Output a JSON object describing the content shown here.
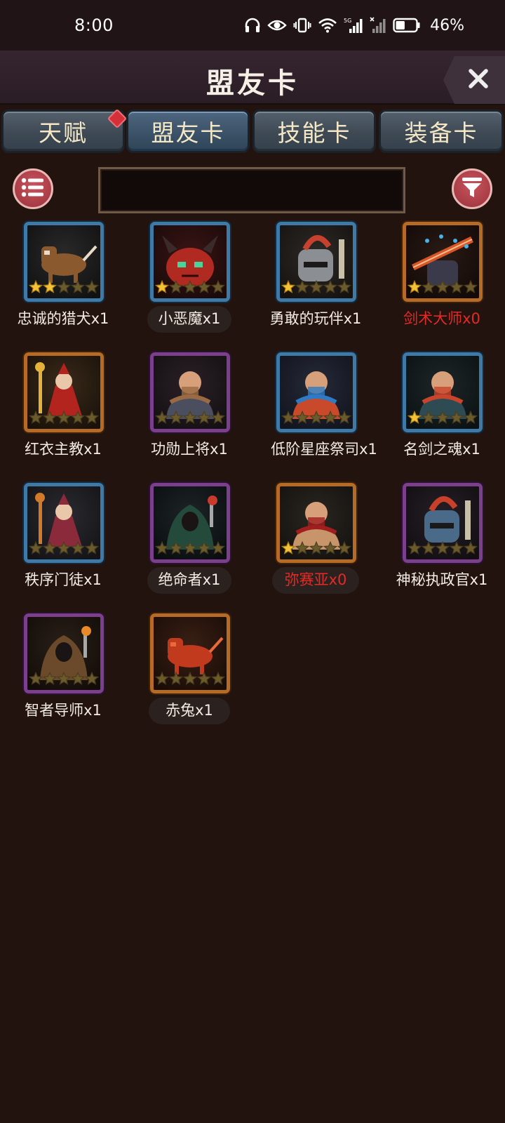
{
  "status_bar": {
    "time": "8:00",
    "battery_percent": "46%",
    "icons": [
      "headphones-icon",
      "eye-icon",
      "vibrate-icon",
      "wifi-icon",
      "signal-5g-icon",
      "signal-no-sim-icon",
      "battery-icon"
    ],
    "battery_level": 0.46
  },
  "header": {
    "title": "盟友卡",
    "close_icon": "close-icon"
  },
  "tabs": [
    {
      "label": "天赋",
      "active": false,
      "badge": true
    },
    {
      "label": "盟友卡",
      "active": true,
      "badge": false
    },
    {
      "label": "技能卡",
      "active": false,
      "badge": false
    },
    {
      "label": "装备卡",
      "active": false,
      "badge": false
    }
  ],
  "toolbar": {
    "list_icon": "list-icon",
    "filter_icon": "filter-icon",
    "search_value": ""
  },
  "cards": [
    {
      "name": "忠诚的猎犬x1",
      "frame": "blue",
      "stars": 2,
      "missing": false,
      "art": "hound"
    },
    {
      "name": "小恶魔x1",
      "frame": "blue",
      "stars": 1,
      "missing": false,
      "art": "imp"
    },
    {
      "name": "勇敢的玩伴x1",
      "frame": "blue",
      "stars": 1,
      "missing": false,
      "art": "knight-helmet"
    },
    {
      "name": "剑术大师x0",
      "frame": "orange",
      "stars": 1,
      "missing": true,
      "art": "swordmaster"
    },
    {
      "name": "红衣主教x1",
      "frame": "orange",
      "stars": 0,
      "missing": false,
      "art": "cardinal"
    },
    {
      "name": "功勋上将x1",
      "frame": "purple",
      "stars": 0,
      "missing": false,
      "art": "general"
    },
    {
      "name": "低阶星座祭司x1",
      "frame": "blue",
      "stars": 0,
      "missing": false,
      "art": "priest"
    },
    {
      "name": "名剑之魂x1",
      "frame": "blue",
      "stars": 1,
      "missing": false,
      "art": "sword-soul"
    },
    {
      "name": "秩序门徒x1",
      "frame": "blue",
      "stars": 0,
      "missing": false,
      "art": "disciple"
    },
    {
      "name": "绝命者x1",
      "frame": "purple",
      "stars": 0,
      "missing": false,
      "art": "assassin"
    },
    {
      "name": "弥赛亚x0",
      "frame": "orange",
      "stars": 1,
      "missing": true,
      "art": "messiah"
    },
    {
      "name": "神秘执政官x1",
      "frame": "purple",
      "stars": 0,
      "missing": false,
      "art": "archon"
    },
    {
      "name": "智者导师x1",
      "frame": "purple",
      "stars": 0,
      "missing": false,
      "art": "sage"
    },
    {
      "name": "赤兔x1",
      "frame": "orange",
      "stars": 0,
      "missing": false,
      "art": "red-horse"
    }
  ],
  "colors": {
    "background": "#23130f",
    "missing_text": "#e42a26",
    "star_filled": "#f3c237",
    "star_empty": "#6b5a2c"
  }
}
